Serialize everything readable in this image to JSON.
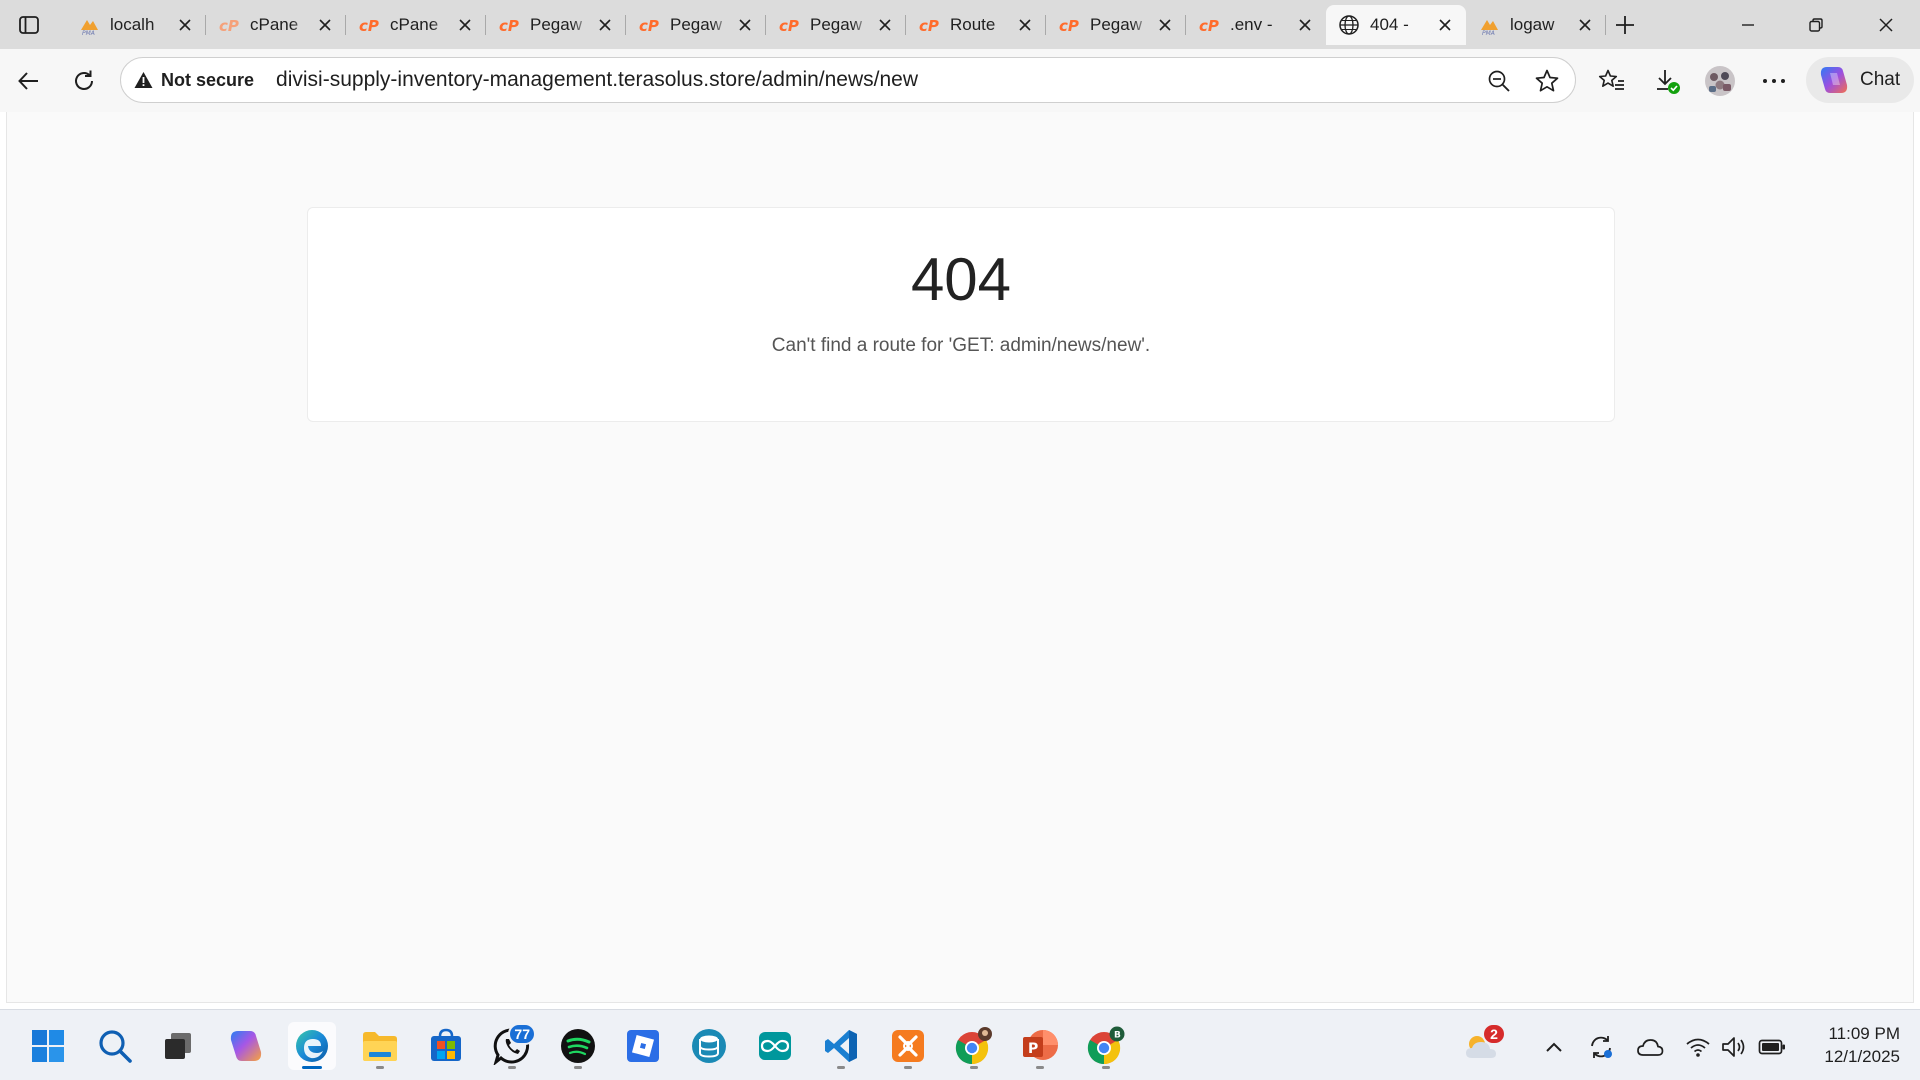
{
  "browser": {
    "tabs": [
      {
        "title": "localh",
        "icon": "phpmyadmin-icon",
        "active": false
      },
      {
        "title": "cPane",
        "icon": "cpanel-icon",
        "active": false
      },
      {
        "title": "cPane",
        "icon": "cpanel-icon",
        "active": false
      },
      {
        "title": "Pegaw",
        "icon": "cpanel-icon",
        "active": false
      },
      {
        "title": "Pegaw",
        "icon": "cpanel-icon",
        "active": false
      },
      {
        "title": "Pegaw",
        "icon": "cpanel-icon",
        "active": false
      },
      {
        "title": "Route",
        "icon": "cpanel-icon",
        "active": false
      },
      {
        "title": "Pegaw",
        "icon": "cpanel-icon",
        "active": false
      },
      {
        "title": ".env -",
        "icon": "cpanel-icon",
        "active": false
      },
      {
        "title": "404 -",
        "icon": "globe-icon",
        "active": true
      },
      {
        "title": "logaw",
        "icon": "phpmyadmin-icon",
        "active": false
      }
    ],
    "address_bar": {
      "security_label": "Not secure",
      "url": "divisi-supply-inventory-management.terasolus.store/admin/news/new"
    },
    "chat_label": "Chat"
  },
  "page": {
    "error_code": "404",
    "error_message": "Can't find a route for 'GET: admin/news/new'."
  },
  "taskbar": {
    "apps": [
      {
        "name": "start",
        "icon": "windows-start-icon"
      },
      {
        "name": "search",
        "icon": "search-icon"
      },
      {
        "name": "task-view",
        "icon": "task-view-icon"
      },
      {
        "name": "copilot",
        "icon": "copilot-icon"
      },
      {
        "name": "edge",
        "icon": "edge-icon",
        "active": true
      },
      {
        "name": "file-explorer",
        "icon": "folder-icon"
      },
      {
        "name": "store",
        "icon": "store-icon"
      },
      {
        "name": "whatsapp",
        "icon": "whatsapp-icon",
        "badge": "77"
      },
      {
        "name": "spotify",
        "icon": "spotify-icon"
      },
      {
        "name": "roblox",
        "icon": "roblox-icon"
      },
      {
        "name": "database-app",
        "icon": "database-icon"
      },
      {
        "name": "arduino",
        "icon": "arduino-icon"
      },
      {
        "name": "vscode",
        "icon": "vscode-icon"
      },
      {
        "name": "xampp",
        "icon": "xampp-icon"
      },
      {
        "name": "chrome-profile-1",
        "icon": "chrome-icon"
      },
      {
        "name": "powerpoint",
        "icon": "powerpoint-icon"
      },
      {
        "name": "chrome-profile-b",
        "icon": "chrome-icon",
        "profile_letter": "B"
      }
    ],
    "weather_badge": "2",
    "clock": {
      "time": "11:09 PM",
      "date": "12/1/2025"
    }
  },
  "colors": {
    "cpanel_orange": "#ff6c2c",
    "edge_blue": "#0c59a4",
    "badge_blue": "#1a6fd6",
    "badge_red": "#d62b2b"
  }
}
